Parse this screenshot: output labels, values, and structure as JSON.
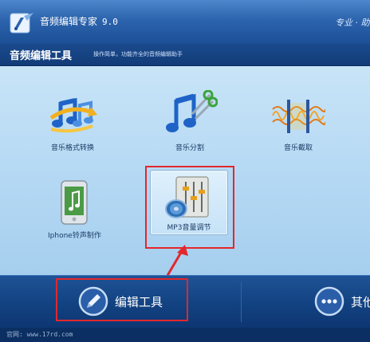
{
  "window": {
    "title": "音频编辑专家",
    "version": "9.0",
    "slogan": "专业 · 助"
  },
  "header": {
    "title": "音频编辑工具",
    "subtitle": "操作简单，功能齐全的音频编辑助手"
  },
  "tools": [
    {
      "label": "音乐格式转换",
      "icon": "music-notes-arrow-icon"
    },
    {
      "label": "音乐分割",
      "icon": "music-note-scissors-icon"
    },
    {
      "label": "音乐截取",
      "icon": "waveform-clip-icon"
    },
    {
      "label": "Iphone铃声制作",
      "icon": "iphone-music-icon"
    },
    {
      "label": "MP3音量调节",
      "icon": "volume-mixer-speaker-icon",
      "selected": true
    }
  ],
  "tabs": [
    {
      "label": "编辑工具",
      "icon": "pencil-icon",
      "active": true
    },
    {
      "label": "其他",
      "icon": "more-icon"
    }
  ],
  "footer": {
    "text": "官网: www.17rd.com"
  },
  "colors": {
    "titlebar": "#2c64ad",
    "content_bg": "#b2d7f3",
    "tabbar": "#134382",
    "annotation_red": "#e3272b"
  }
}
